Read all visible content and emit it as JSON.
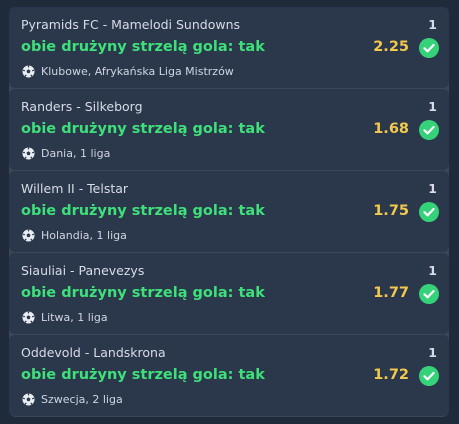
{
  "colors": {
    "page_bg": "#1f2a3a",
    "panel_bg": "#3b4658",
    "card_bg": "#2b374b",
    "bet_text": "#3ee07a",
    "odds_text": "#f2c94c",
    "check_bg": "#36d27a"
  },
  "bets": [
    {
      "match": "Pyramids FC - Mamelodi Sundowns",
      "count": "1",
      "selection": "obie drużyny strzelą gola: tak",
      "odds": "2.25",
      "league": "Klubowe, Afrykańska Liga Mistrzów",
      "league_icon": "soccer-ball-icon",
      "status_icon": "check-circle-icon"
    },
    {
      "match": "Randers - Silkeborg",
      "count": "1",
      "selection": "obie drużyny strzelą gola: tak",
      "odds": "1.68",
      "league": "Dania, 1 liga",
      "league_icon": "soccer-ball-icon",
      "status_icon": "check-circle-icon"
    },
    {
      "match": "Willem II - Telstar",
      "count": "1",
      "selection": "obie drużyny strzelą gola: tak",
      "odds": "1.75",
      "league": "Holandia, 1 liga",
      "league_icon": "soccer-ball-icon",
      "status_icon": "check-circle-icon"
    },
    {
      "match": "Siauliai - Panevezys",
      "count": "1",
      "selection": "obie drużyny strzelą gola: tak",
      "odds": "1.77",
      "league": "Litwa, 1 liga",
      "league_icon": "soccer-ball-icon",
      "status_icon": "check-circle-icon"
    },
    {
      "match": "Oddevold - Landskrona",
      "count": "1",
      "selection": "obie drużyny strzelą gola: tak",
      "odds": "1.72",
      "league": "Szwecja, 2 liga",
      "league_icon": "soccer-ball-icon",
      "status_icon": "check-circle-icon"
    }
  ]
}
